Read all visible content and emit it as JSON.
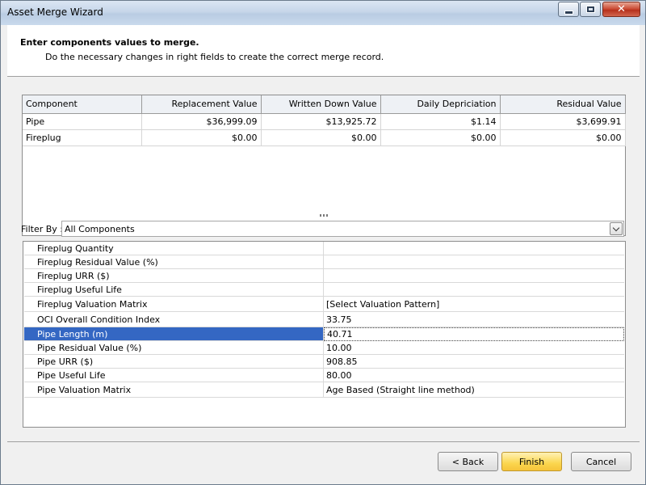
{
  "window": {
    "title": "Asset Merge Wizard"
  },
  "header": {
    "title": "Enter components values to merge.",
    "subtitle": "Do the necessary changes in right fields to create the correct merge record."
  },
  "components_table": {
    "columns": [
      "Component",
      "Replacement Value",
      "Written Down Value",
      "Daily Depriciation",
      "Residual Value"
    ],
    "rows": [
      [
        "Pipe",
        "$36,999.09",
        "$13,925.72",
        "$1.14",
        "$3,699.91"
      ],
      [
        "Fireplug",
        "$0.00",
        "$0.00",
        "$0.00",
        "$0.00"
      ]
    ]
  },
  "filter": {
    "label": "Filter By :",
    "value": "All Components"
  },
  "properties": [
    {
      "name": "Fireplug Quantity",
      "value": ""
    },
    {
      "name": "Fireplug Residual Value (%)",
      "value": ""
    },
    {
      "name": "Fireplug URR ($)",
      "value": ""
    },
    {
      "name": "Fireplug Useful Life",
      "value": ""
    },
    {
      "name": "Fireplug Valuation Matrix",
      "value": "[Select Valuation Pattern]"
    },
    {
      "name": "OCI Overall Condition Index",
      "value": "33.75"
    },
    {
      "name": "Pipe Length (m)",
      "value": "40.71",
      "selected": true
    },
    {
      "name": "Pipe Residual Value (%)",
      "value": "10.00"
    },
    {
      "name": "Pipe URR ($)",
      "value": "908.85"
    },
    {
      "name": "Pipe Useful Life",
      "value": "80.00"
    },
    {
      "name": "Pipe Valuation Matrix",
      "value": "Age Based (Straight line method)"
    }
  ],
  "buttons": {
    "back": "< Back",
    "finish": "Finish",
    "cancel": "Cancel"
  },
  "colors": {
    "selection": "#3467c3",
    "finish_button": "#fbd64e"
  }
}
